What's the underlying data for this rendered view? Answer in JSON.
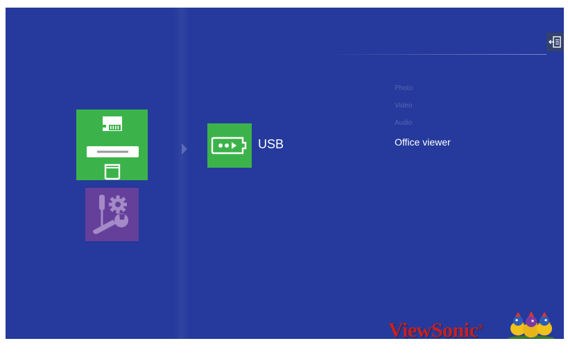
{
  "colors": {
    "background": "#253a9c",
    "tile_green": "#3cb34a",
    "tile_purple": "#65409b",
    "brand_red": "#c8201f"
  },
  "header": {
    "exit_icon": "exit-icon"
  },
  "sidebar": {
    "tiles": [
      {
        "id": "storage",
        "icon": "storage-devices-icon",
        "selected": true
      },
      {
        "id": "settings",
        "icon": "tools-settings-icon",
        "selected": false
      }
    ]
  },
  "source": {
    "label": "USB",
    "icon": "usb-drive-icon"
  },
  "menu": {
    "items": [
      {
        "label": "Photo",
        "active": false
      },
      {
        "label": "Video",
        "active": false
      },
      {
        "label": "Audio",
        "active": false
      },
      {
        "label": "Office viewer",
        "active": true
      }
    ]
  },
  "brand": {
    "name": "ViewSonic",
    "mark": "®",
    "logo_icon": "viewsonic-birds-logo"
  }
}
